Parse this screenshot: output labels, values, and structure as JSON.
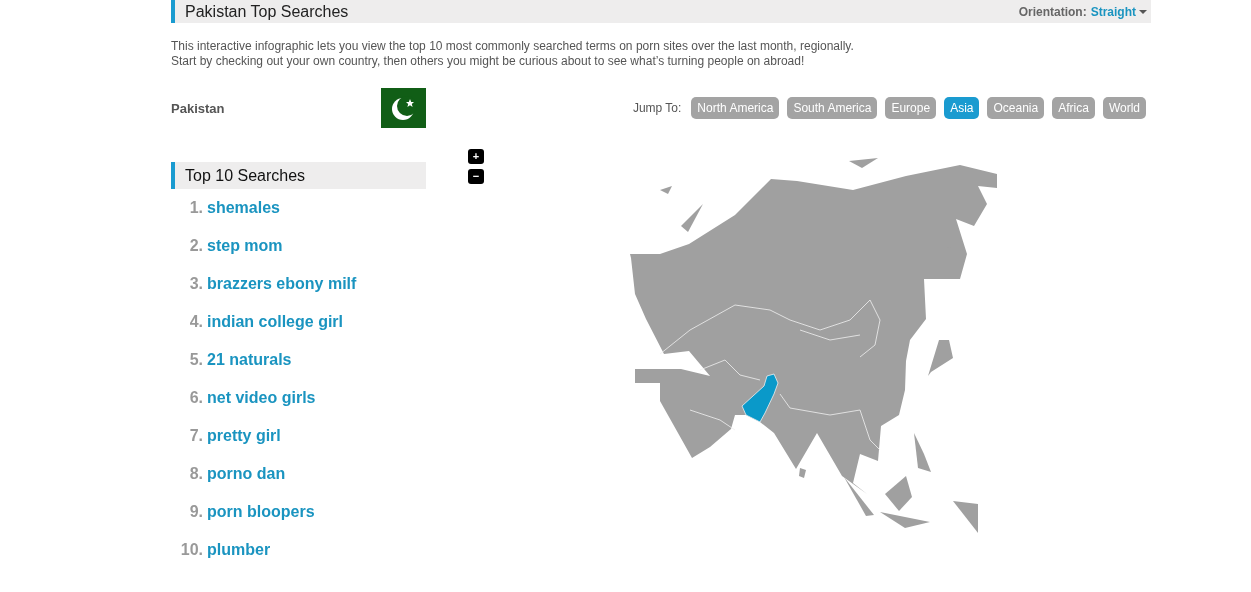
{
  "header": {
    "title": "Pakistan Top Searches",
    "orientation_label": "Orientation:",
    "orientation_value": "Straight"
  },
  "intro": [
    "This interactive infographic lets you view the top 10 most commonly searched terms on porn sites over the last month, regionally.",
    "Start by checking out your own country, then others you might be curious about to see what’s turning people on abroad!"
  ],
  "country": "Pakistan",
  "jump": {
    "label": "Jump To:",
    "regions": [
      {
        "label": "North America",
        "selected": false
      },
      {
        "label": "South America",
        "selected": false
      },
      {
        "label": "Europe",
        "selected": false
      },
      {
        "label": "Asia",
        "selected": true
      },
      {
        "label": "Oceania",
        "selected": false
      },
      {
        "label": "Africa",
        "selected": false
      },
      {
        "label": "World",
        "selected": false
      }
    ]
  },
  "zoom": [
    "+",
    "−"
  ],
  "top_searches": {
    "title": "Top 10 Searches",
    "items": [
      {
        "rank": "1.",
        "term": "shemales"
      },
      {
        "rank": "2.",
        "term": "step mom"
      },
      {
        "rank": "3.",
        "term": "brazzers ebony milf"
      },
      {
        "rank": "4.",
        "term": "indian college girl"
      },
      {
        "rank": "5.",
        "term": "21 naturals"
      },
      {
        "rank": "6.",
        "term": "net video girls"
      },
      {
        "rank": "7.",
        "term": "pretty girl"
      },
      {
        "rank": "8.",
        "term": "porno dan"
      },
      {
        "rank": "9.",
        "term": "porn bloopers"
      },
      {
        "rank": "10.",
        "term": "plumber"
      }
    ]
  }
}
